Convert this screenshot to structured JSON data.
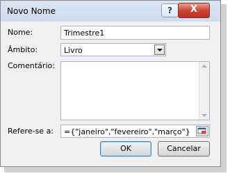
{
  "window": {
    "title": "Novo Nome",
    "help_label": "?",
    "close_label": "X"
  },
  "fields": {
    "name_label": "Nome:",
    "name_value": "Trimestre1",
    "scope_label": "Âmbito:",
    "scope_value": "Livro",
    "comment_label": "Comentário:",
    "comment_value": "",
    "refers_label": "Refere-se a:",
    "refers_value": "={\"janeiro\",\"fevereiro\",\"março\"}"
  },
  "buttons": {
    "ok": "OK",
    "cancel": "Cancelar"
  },
  "colors": {
    "title_bar": "#cfdcef",
    "close_button": "#c9463a",
    "default_border": "#3c7fb1"
  }
}
